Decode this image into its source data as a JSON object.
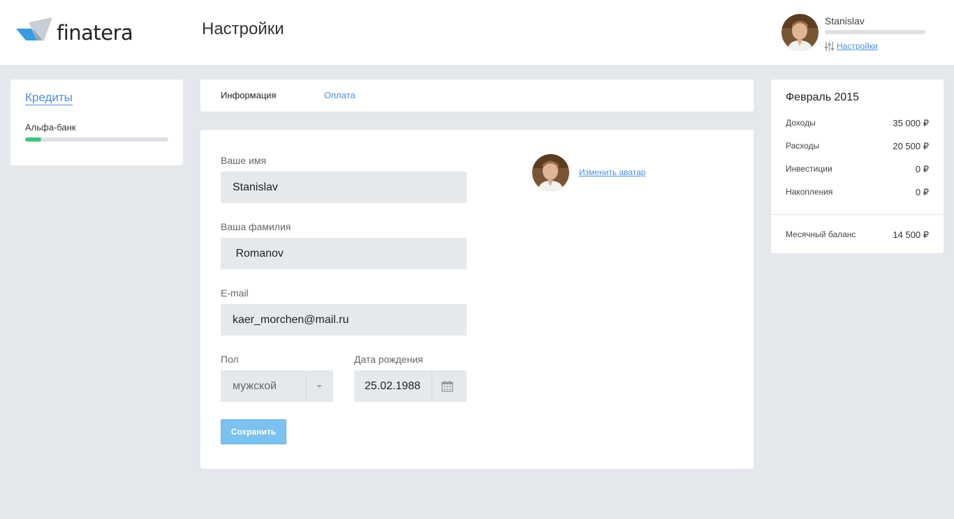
{
  "header": {
    "logo_text": "finatera",
    "logo_tm": "™",
    "page_title": "Настройки",
    "user_name": "Stanislav",
    "settings_link": "Настройки"
  },
  "credits": {
    "title": "Кредиты",
    "items": [
      {
        "bank": "Альфа-банк",
        "progress": 0.11
      }
    ]
  },
  "tabs": [
    {
      "label": "Информация",
      "active": true
    },
    {
      "label": "Оплата",
      "active": false
    }
  ],
  "form": {
    "first_name_label": "Ваше имя",
    "first_name_value": "Stanislav",
    "last_name_label": "Ваша фамилия",
    "last_name_value": " Romanov",
    "email_label": "E-mail",
    "email_value": "kaer_morchen@mail.ru",
    "gender_label": "Пол",
    "gender_value": "мужской",
    "birth_label": "Дата рождения",
    "birth_value": "25.02.1988",
    "save_label": "Сохранить",
    "change_avatar_label": "Изменить аватар"
  },
  "summary": {
    "title": "Февраль 2015",
    "rows": [
      {
        "label": "Доходы",
        "value": "35 000 ₽"
      },
      {
        "label": "Расходы",
        "value": "20 500 ₽"
      },
      {
        "label": "Инвестиции",
        "value": "0 ₽"
      },
      {
        "label": "Накопления",
        "value": "0 ₽"
      }
    ],
    "balance_label": "Месячный баланс",
    "balance_value": "14 500 ₽"
  },
  "colors": {
    "accent": "#4a90d9",
    "progress": "#43c47a",
    "background": "#e4e7eb",
    "save_button": "#7cc2f0"
  },
  "icons": [
    "finatera-logo-icon",
    "sliders-icon",
    "calendar-icon",
    "chevron-down-icon"
  ]
}
